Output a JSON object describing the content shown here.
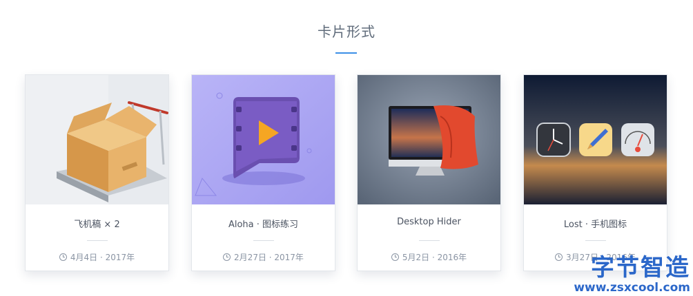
{
  "section": {
    "title": "卡片形式"
  },
  "cards": [
    {
      "title": "飞机稿 × 2",
      "date": "4月4日 · 2017年",
      "image": "cardboard-box-on-cart",
      "colors": {
        "bg": "#e6e9ee",
        "box": "#e2a85a"
      }
    },
    {
      "title": "Aloha · 图标练习",
      "date": "2月27日 · 2017年",
      "image": "video-film-play-icon",
      "colors": {
        "bg": "#a9a4f3",
        "icon": "#6a4fb0",
        "play": "#f5a623"
      }
    },
    {
      "title": "Desktop Hider",
      "date": "5月2日 · 2016年",
      "image": "monitor-with-red-cloth",
      "colors": {
        "bg": "#6a778c",
        "cloth": "#e2492e"
      }
    },
    {
      "title": "Lost · 手机图标",
      "date": "3月27日 · 2016年",
      "image": "clock-pencil-gauge-app-icons",
      "colors": {
        "bg": "#1b2438",
        "accent": "#e2a24a"
      }
    }
  ],
  "watermark": {
    "brand": "字节智造",
    "url": "www.zsxcool.com"
  }
}
